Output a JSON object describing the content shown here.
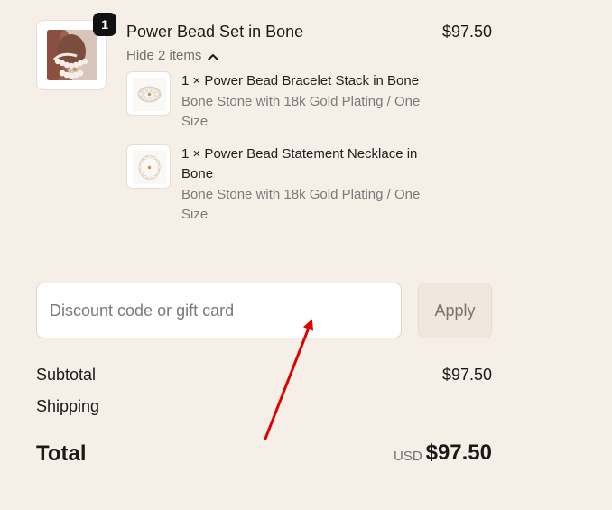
{
  "cart": {
    "main_item": {
      "quantity": "1",
      "title": "Power Bead Set in Bone",
      "price": "$97.50",
      "toggle_label": "Hide 2 items"
    },
    "sub_items": [
      {
        "title": "1 × Power Bead Bracelet Stack in Bone",
        "variant": "Bone Stone with 18k Gold Plating / One Size"
      },
      {
        "title": "1 × Power Bead Statement Necklace in Bone",
        "variant": "Bone Stone with 18k Gold Plating / One Size"
      }
    ]
  },
  "discount": {
    "placeholder": "Discount code or gift card",
    "button_label": "Apply"
  },
  "summary": {
    "subtotal_label": "Subtotal",
    "subtotal_value": "$97.50",
    "shipping_label": "Shipping",
    "total_label": "Total",
    "currency": "USD",
    "total_value": "$97.50"
  },
  "icons": {
    "toggle_icon": "chevron-up-icon"
  },
  "colors": {
    "background": "#f6efe8",
    "badge": "#111111",
    "annotation": "#e00000"
  }
}
